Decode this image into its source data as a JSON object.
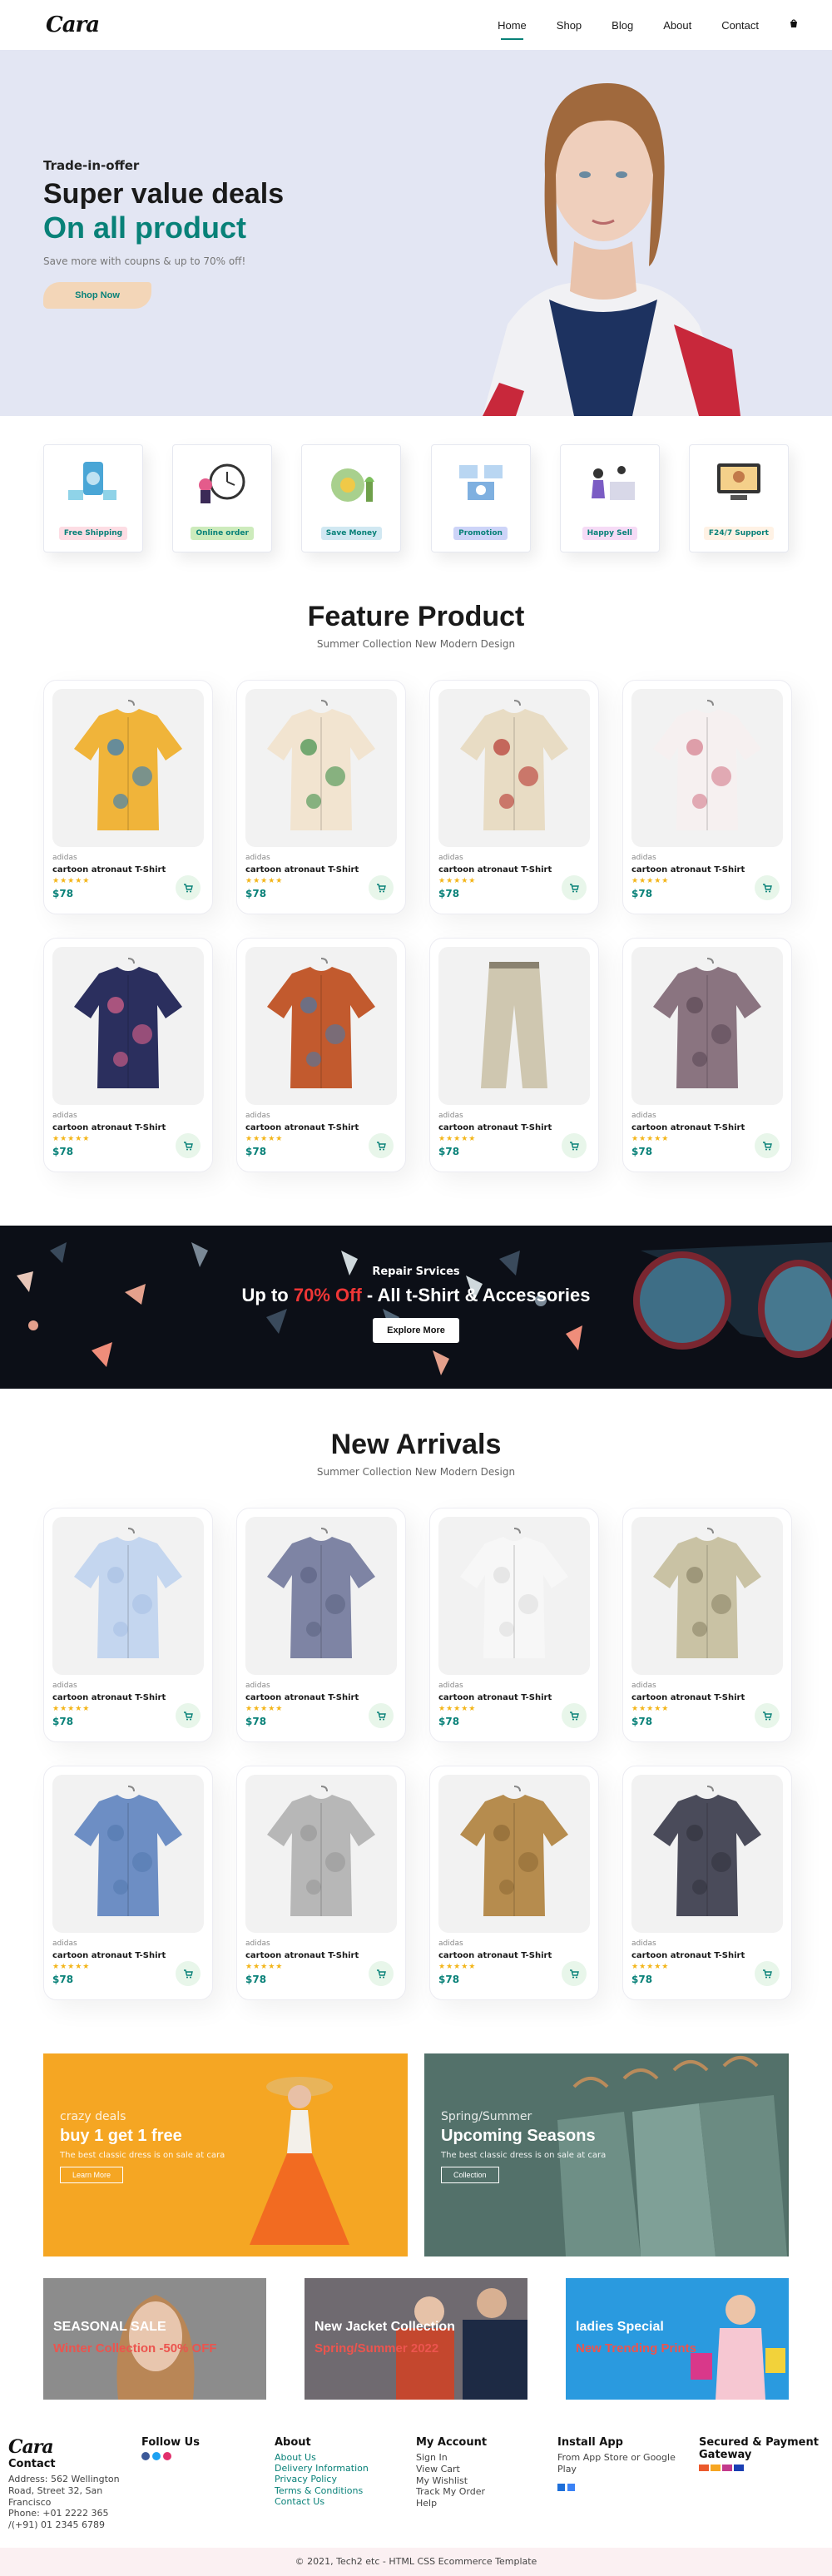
{
  "header": {
    "logo": "Cara",
    "nav": [
      "Home",
      "Shop",
      "Blog",
      "About",
      "Contact"
    ],
    "active_nav": "Home"
  },
  "hero": {
    "tag": "Trade-in-offer",
    "title": "Super value deals",
    "highlight": "On all product",
    "subtitle": "Save more with coupns & up to 70% off!",
    "button": "Shop Now"
  },
  "features": [
    {
      "label": "Free Shipping",
      "bg": "#fddde4"
    },
    {
      "label": "Online order",
      "bg": "#cdebbc"
    },
    {
      "label": "Save Money",
      "bg": "#d1e8f2"
    },
    {
      "label": "Promotion",
      "bg": "#cdd4f8"
    },
    {
      "label": "Happy Sell",
      "bg": "#f6dbf6"
    },
    {
      "label": "F24/7 Support",
      "bg": "#fff2e5"
    }
  ],
  "featured": {
    "title": "Feature Product",
    "subtitle": "Summer Collection New Modern Design",
    "products": [
      {
        "brand": "adidas",
        "name": "cartoon atronaut T-Shirt",
        "stars": "★★★★★",
        "price": "$78"
      },
      {
        "brand": "adidas",
        "name": "cartoon atronaut T-Shirt",
        "stars": "★★★★★",
        "price": "$78"
      },
      {
        "brand": "adidas",
        "name": "cartoon atronaut T-Shirt",
        "stars": "★★★★★",
        "price": "$78"
      },
      {
        "brand": "adidas",
        "name": "cartoon atronaut T-Shirt",
        "stars": "★★★★★",
        "price": "$78"
      },
      {
        "brand": "adidas",
        "name": "cartoon atronaut T-Shirt",
        "stars": "★★★★★",
        "price": "$78"
      },
      {
        "brand": "adidas",
        "name": "cartoon atronaut T-Shirt",
        "stars": "★★★★★",
        "price": "$78"
      },
      {
        "brand": "adidas",
        "name": "cartoon atronaut T-Shirt",
        "stars": "★★★★★",
        "price": "$78"
      },
      {
        "brand": "adidas",
        "name": "cartoon atronaut T-Shirt",
        "stars": "★★★★★",
        "price": "$78"
      }
    ]
  },
  "promo": {
    "tag": "Repair Srvices",
    "pre": "Up to ",
    "highlight": "70% Off",
    "post": " - All t-Shirt & Accessories",
    "button": "Explore More"
  },
  "arrivals": {
    "title": "New Arrivals",
    "subtitle": "Summer Collection New Modern Design",
    "products": [
      {
        "brand": "adidas",
        "name": "cartoon atronaut T-Shirt",
        "stars": "★★★★★",
        "price": "$78"
      },
      {
        "brand": "adidas",
        "name": "cartoon atronaut T-Shirt",
        "stars": "★★★★★",
        "price": "$78"
      },
      {
        "brand": "adidas",
        "name": "cartoon atronaut T-Shirt",
        "stars": "★★★★★",
        "price": "$78"
      },
      {
        "brand": "adidas",
        "name": "cartoon atronaut T-Shirt",
        "stars": "★★★★★",
        "price": "$78"
      },
      {
        "brand": "adidas",
        "name": "cartoon atronaut T-Shirt",
        "stars": "★★★★★",
        "price": "$78"
      },
      {
        "brand": "adidas",
        "name": "cartoon atronaut T-Shirt",
        "stars": "★★★★★",
        "price": "$78"
      },
      {
        "brand": "adidas",
        "name": "cartoon atronaut T-Shirt",
        "stars": "★★★★★",
        "price": "$78"
      },
      {
        "brand": "adidas",
        "name": "cartoon atronaut T-Shirt",
        "stars": "★★★★★",
        "price": "$78"
      }
    ]
  },
  "banners": {
    "left": {
      "small": "crazy deals",
      "title": "buy 1 get 1 free",
      "text": "The best classic dress is on sale at cara",
      "button": "Learn More"
    },
    "right": {
      "small": "Spring/Summer",
      "title": "Upcoming Seasons",
      "text": "The best classic dress is on sale at cara",
      "button": "Collection"
    }
  },
  "trio": [
    {
      "title": "SEASONAL SALE",
      "sub": "Winter Collection -50% OFF"
    },
    {
      "title": "New Jacket Collection",
      "sub": "Spring/Summer 2022"
    },
    {
      "title": "ladies Special",
      "sub": "New Trending Prints"
    }
  ],
  "footer": {
    "logo": "Cara",
    "contact_title": "Contact",
    "address": "Address: 562 Wellington Road, Street 32, San Francisco",
    "phone": "Phone: +01 2222 365 /(+91) 01 2345 6789",
    "follow_title": "Follow Us",
    "about_title": "About",
    "about_links": [
      "About Us",
      "Delivery Information",
      "Privacy Policy",
      "Terms & Conditions",
      "Contact Us"
    ],
    "account_title": "My Account",
    "account_links": [
      "Sign In",
      "View Cart",
      "My Wishlist",
      "Track My Order",
      "Help"
    ],
    "install_title": "Install App",
    "install_text": "From App Store or Google Play",
    "payment_title": "Secured & Payment Gateway",
    "copyright": "© 2021, Tech2 etc - HTML CSS Ecommerce Template"
  }
}
